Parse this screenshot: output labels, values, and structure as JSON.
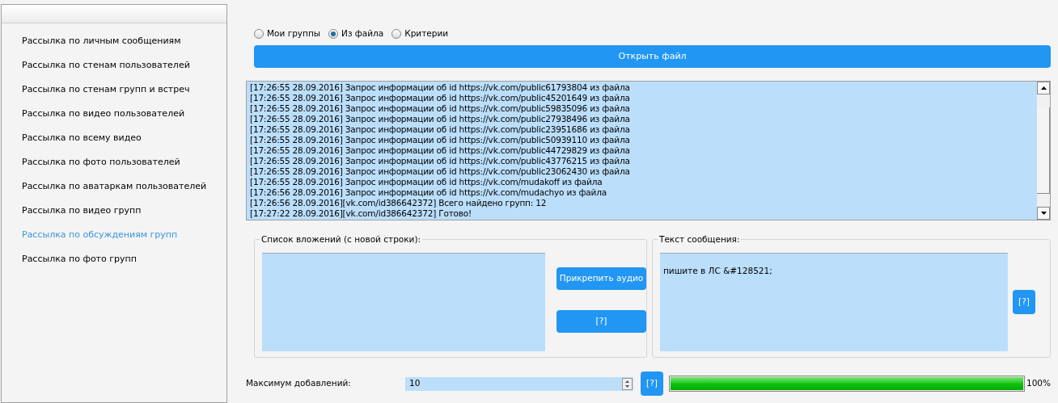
{
  "sidebar": {
    "items": [
      {
        "label": "Рассылка по личным сообщениям",
        "selected": false
      },
      {
        "label": "Рассылка по стенам пользователей",
        "selected": false
      },
      {
        "label": "Рассылка по стенам групп и встреч",
        "selected": false
      },
      {
        "label": "Рассылка по видео пользователей",
        "selected": false
      },
      {
        "label": "Рассылка по всему видео",
        "selected": false
      },
      {
        "label": "Рассылка по фото пользователей",
        "selected": false
      },
      {
        "label": "Рассылка по аватаркам пользователей",
        "selected": false
      },
      {
        "label": "Рассылка по видео групп",
        "selected": false
      },
      {
        "label": "Рассылка по обсуждениям групп",
        "selected": true
      },
      {
        "label": "Рассылка по фото групп",
        "selected": false
      }
    ]
  },
  "source": {
    "options": [
      {
        "label": "Мои группы",
        "selected": false
      },
      {
        "label": "Из файла",
        "selected": true
      },
      {
        "label": "Критерии",
        "selected": false
      }
    ],
    "open_button": "Открыть файл"
  },
  "log": {
    "lines": [
      "[17:26:55 28.09.2016] Запрос информации об id https://vk.com/public61793804 из файла",
      "[17:26:55 28.09.2016] Запрос информации об id https://vk.com/public45201649 из файла",
      "[17:26:55 28.09.2016] Запрос информации об id https://vk.com/public59835096 из файла",
      "[17:26:55 28.09.2016] Запрос информации об id https://vk.com/public27938496 из файла",
      "[17:26:55 28.09.2016] Запрос информации об id https://vk.com/public23951686 из файла",
      "[17:26:55 28.09.2016] Запрос информации об id https://vk.com/public50939110 из файла",
      "[17:26:55 28.09.2016] Запрос информации об id https://vk.com/public44729829 из файла",
      "[17:26:55 28.09.2016] Запрос информации об id https://vk.com/public43776215 из файла",
      "[17:26:55 28.09.2016] Запрос информации об id https://vk.com/public23062430 из файла",
      "[17:26:55 28.09.2016] Запрос информации об id https://vk.com/mudakoff из файла",
      "[17:26:56 28.09.2016] Запрос информации об id https://vk.com/mudachyo из файла",
      "[17:26:56 28.09.2016][vk.com/id386642372] Всего найдено групп: 12",
      "[17:27:22 28.09.2016][vk.com/id386642372] Готово!"
    ]
  },
  "attachments": {
    "title": "Список вложений (с новой строки):",
    "attach_audio_button": "Прикрепить аудио",
    "help_button": "[?]"
  },
  "message": {
    "title": "Текст сообщения:",
    "value": "пишите в ЛС &#128521;",
    "help_button": "[?]"
  },
  "max_additions": {
    "label": "Максимум добавлений:",
    "value": "10",
    "help_button": "[?]"
  },
  "progress": {
    "level": 1,
    "reading": "100%"
  }
}
